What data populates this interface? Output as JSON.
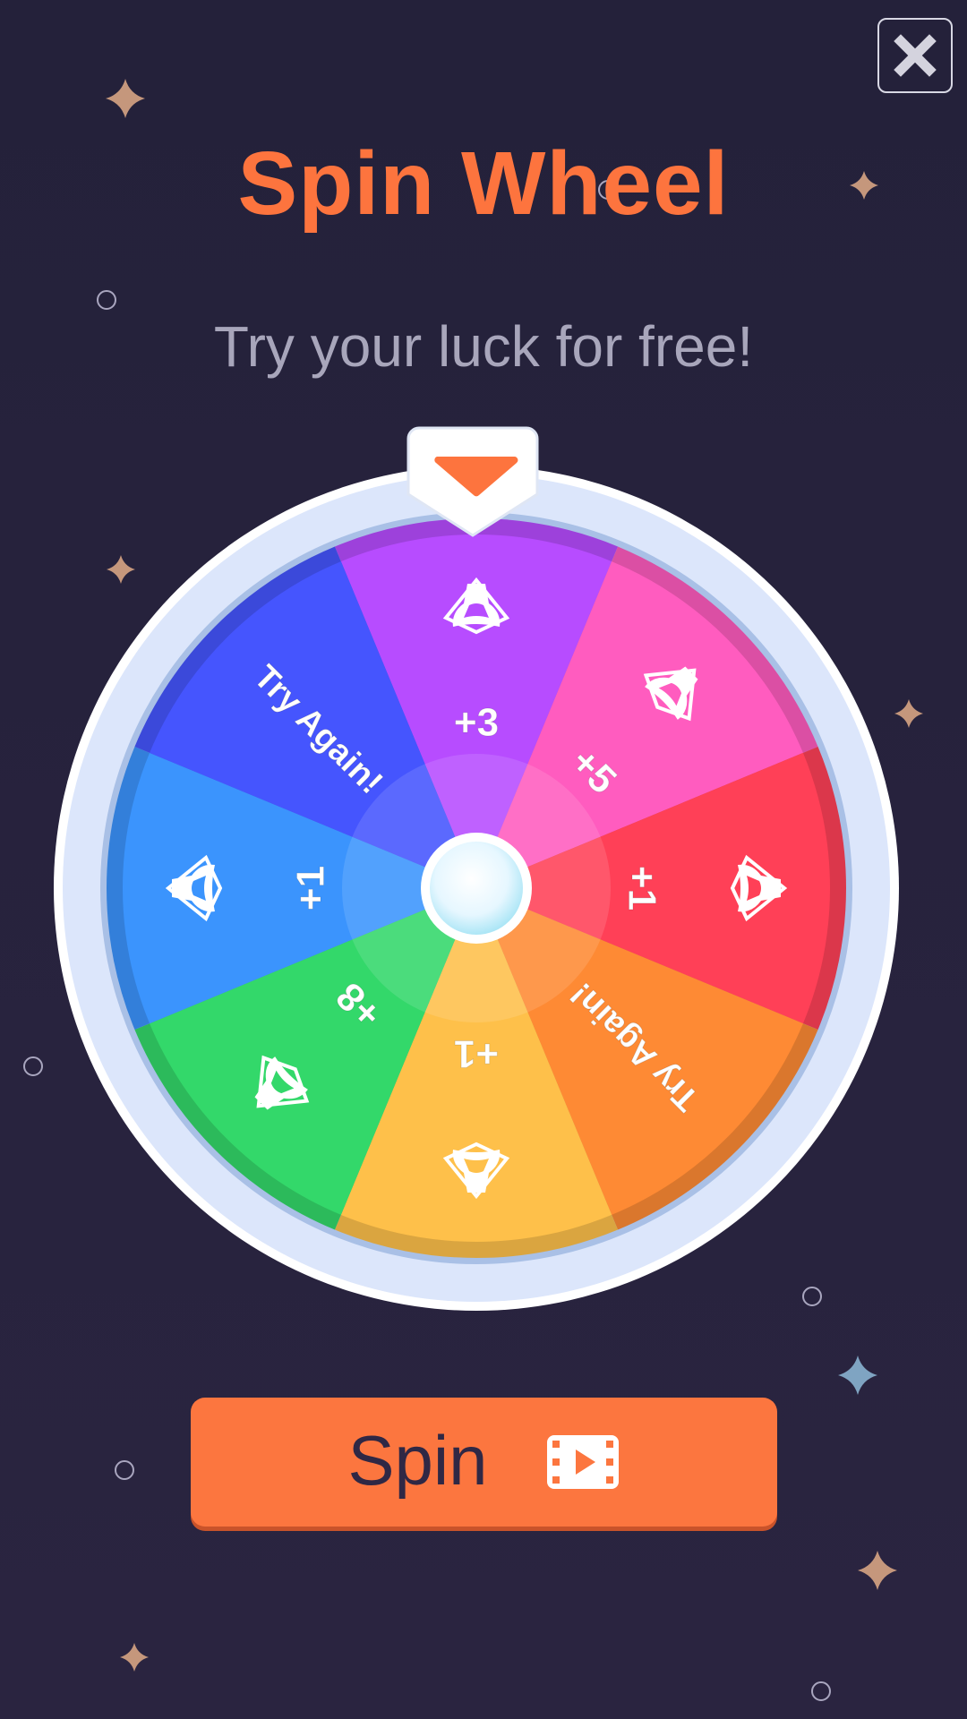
{
  "header": {
    "title": "Spin Wheel",
    "subtitle": "Try your luck for free!"
  },
  "close_button": {
    "icon": "close-icon"
  },
  "wheel": {
    "segments": [
      {
        "label": "+3",
        "color": "#b74cff",
        "icon": "axe-icon"
      },
      {
        "label": "+5",
        "color": "#ff5cbf",
        "icon": "axe-icon"
      },
      {
        "label": "+1",
        "color": "#ff4057",
        "icon": "axe-icon"
      },
      {
        "label": "Try Again!",
        "color": "#fe8a34",
        "icon": ""
      },
      {
        "label": "+1",
        "color": "#fec04a",
        "icon": "axe-icon"
      },
      {
        "label": "+8",
        "color": "#33d86a",
        "icon": "axe-icon"
      },
      {
        "label": "+1",
        "color": "#3b94fd",
        "icon": "axe-icon"
      },
      {
        "label": "Try Again!",
        "color": "#4555fe",
        "icon": ""
      }
    ],
    "pointer_color": "#fd743e",
    "rim_color": "#dce6fb"
  },
  "spin_button": {
    "label": "Spin",
    "icon": "video-ad-icon",
    "color": "#fc763f"
  },
  "colors": {
    "background": "#27233a",
    "accent": "#fd743e",
    "star": "#c5977c",
    "star_blue": "#7fa4c2"
  }
}
